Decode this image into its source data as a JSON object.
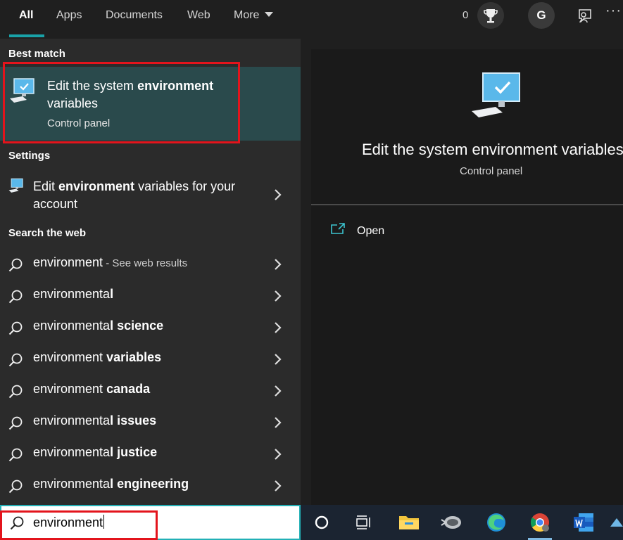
{
  "tabs": [
    {
      "label": "All",
      "active": true
    },
    {
      "label": "Apps"
    },
    {
      "label": "Documents"
    },
    {
      "label": "Web"
    },
    {
      "label": "More"
    }
  ],
  "header": {
    "points": "0",
    "avatar_initial": "G",
    "icons": [
      "trophy-icon",
      "feedback-icon",
      "more-options-icon"
    ]
  },
  "sections": {
    "best_match": "Best match",
    "settings": "Settings",
    "search_web": "Search the web"
  },
  "best_match": {
    "title_pre": "Edit the system ",
    "title_bold": "environment",
    "title_post": "variables",
    "subtitle": "Control panel",
    "icon": "computer-icon"
  },
  "settings_item": {
    "pre": "Edit ",
    "bold": "environment",
    "post": " variables for your",
    "line2": "account",
    "icon": "computer-icon"
  },
  "web_results": [
    {
      "pre": "environment",
      "bold": "",
      "hint": " - See web results"
    },
    {
      "pre": "environmenta",
      "bold": "l",
      "hint": ""
    },
    {
      "pre": "environmenta",
      "bold": "l science",
      "hint": ""
    },
    {
      "pre": "environment ",
      "bold": "variables",
      "hint": ""
    },
    {
      "pre": "environment ",
      "bold": "canada",
      "hint": ""
    },
    {
      "pre": "environmenta",
      "bold": "l issues",
      "hint": ""
    },
    {
      "pre": "environmenta",
      "bold": "l justice",
      "hint": ""
    },
    {
      "pre": "environmenta",
      "bold": "l engineering",
      "hint": ""
    }
  ],
  "preview": {
    "title": "Edit the system environment variables",
    "subtitle": "Control panel",
    "actions": [
      {
        "label": "Open",
        "icon": "open-icon"
      }
    ]
  },
  "search": {
    "value": "environment"
  },
  "taskbar": {
    "items": [
      "cortana-icon",
      "task-view-icon",
      "file-explorer-icon",
      "app-icon",
      "edge-icon",
      "chrome-icon",
      "word-icon"
    ],
    "active": [
      "chrome-icon"
    ]
  },
  "colors": {
    "accent": "#19a2a8",
    "highlight_bg": "#2a4a4c",
    "annotation_red": "#e3141c",
    "taskbar_bg": "#1b2431"
  }
}
